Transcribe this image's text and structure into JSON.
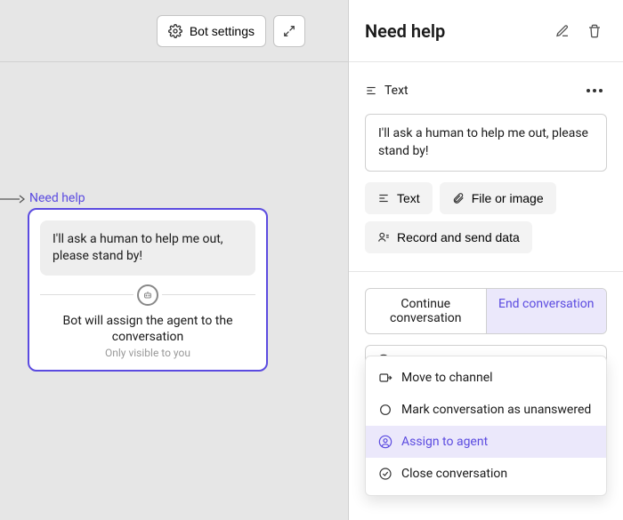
{
  "canvas": {
    "bot_settings_label": "Bot settings",
    "node_title": "Need help",
    "bubble_text": "I'll ask a human to help me out, please stand by!",
    "assign_text": "Bot will assign the agent to the conversation",
    "only_visible": "Only visible to you"
  },
  "panel": {
    "title": "Need help",
    "block_label": "Text",
    "text_value": "I'll ask a human to help me out, please stand by!",
    "add_text": "Text",
    "add_file": "File or image",
    "add_record": "Record and send data",
    "seg_continue": "Continue conversation",
    "seg_end": "End conversation",
    "select_value": "Assign to agent",
    "dropdown": {
      "move": "Move to channel",
      "mark": "Mark conversation as unanswered",
      "assign": "Assign to agent",
      "close": "Close conversation"
    }
  }
}
